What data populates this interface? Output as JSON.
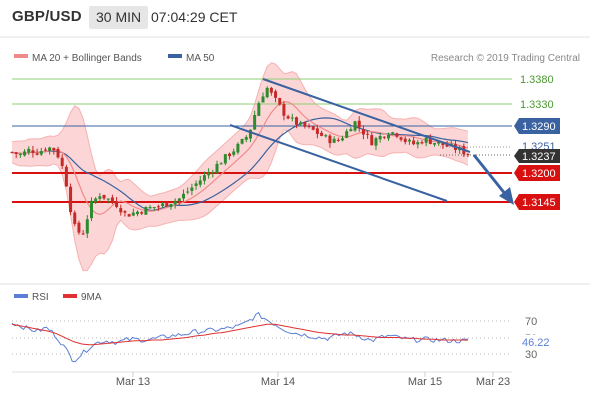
{
  "header": {
    "symbol": "GBP/USD",
    "timeframe": "30 MIN",
    "time": "07:04:29 CET"
  },
  "legend_main": [
    {
      "name": "MA 20 + Bollinger Bands",
      "color": "#f08a8a"
    },
    {
      "name": "MA 50",
      "color": "#3a62a0"
    }
  ],
  "attribution": "Research © 2019 Trading Central",
  "price_tags": {
    "r2": "1.3380",
    "r1": "1.3330",
    "pivot": "1.3290",
    "upper": "1.3251",
    "last": "1.3237",
    "s1": "1.3200",
    "s2": "1.3145"
  },
  "legend_rsi": [
    {
      "name": "RSI",
      "color": "#5b7fd6"
    },
    {
      "name": "9MA",
      "color": "#e03030"
    }
  ],
  "rsi_axis": {
    "level_high": "70",
    "level_mid": "50",
    "level_low": "30",
    "current": "46.22"
  },
  "x_axis": [
    "Mar 13",
    "Mar 14",
    "Mar 15",
    "Mar 23"
  ],
  "colors": {
    "candle_up": "#2e8b2e",
    "candle_down": "#c62828",
    "resistance": "#8ccf74",
    "pivot": "#3a62a0",
    "support": "#d81010",
    "channel": "#3a62a0",
    "arrow": "#3a62a0",
    "band_fill": "#fcd6d6",
    "last_tag": "#333333"
  },
  "chart_data": {
    "type": "candlestick",
    "symbol": "GBP/USD",
    "interval": "30 MIN",
    "x_ticks": [
      "Mar 13",
      "Mar 14",
      "Mar 15",
      "Mar 23"
    ],
    "price_range": [
      1.3045,
      1.3405
    ],
    "key_levels": {
      "resistance_2": 1.338,
      "resistance_1": 1.333,
      "pivot": 1.329,
      "support_1": 1.32,
      "support_2": 1.3145
    },
    "last_price": 1.3237,
    "ma20_close": 1.3245,
    "bollinger_upper": 1.3251,
    "indicators": [
      "MA 20 + Bollinger Bands",
      "MA 50"
    ],
    "outlook": "bearish",
    "price_path": [
      1.324,
      1.3235,
      1.3245,
      1.324,
      1.325,
      1.3245,
      1.32,
      1.31,
      1.308,
      1.314,
      1.316,
      1.315,
      1.314,
      1.312,
      1.3125,
      1.313,
      1.3135,
      1.3138,
      1.3145,
      1.315,
      1.3165,
      1.318,
      1.3195,
      1.321,
      1.3225,
      1.324,
      1.3255,
      1.3275,
      1.333,
      1.3365,
      1.334,
      1.3315,
      1.33,
      1.329,
      1.3285,
      1.3275,
      1.3265,
      1.326,
      1.3275,
      1.33,
      1.328,
      1.326,
      1.327,
      1.328,
      1.3275,
      1.326,
      1.3255,
      1.3265,
      1.326,
      1.3255,
      1.325,
      1.3245,
      1.3237
    ],
    "rsi": {
      "levels": [
        30,
        50,
        70
      ],
      "current": 46.22,
      "rsi_path": [
        68,
        64,
        60,
        58,
        62,
        52,
        38,
        22,
        30,
        40,
        45,
        46,
        44,
        47,
        48,
        47,
        48,
        50,
        52,
        53,
        55,
        57,
        58,
        59,
        60,
        62,
        64,
        70,
        78,
        72,
        66,
        60,
        56,
        54,
        52,
        50,
        49,
        52,
        55,
        54,
        50,
        46,
        50,
        52,
        50,
        48,
        47,
        48,
        47,
        47,
        46,
        46,
        46.22
      ],
      "ma9_path": [
        66,
        64,
        62,
        60,
        58,
        55,
        50,
        45,
        42,
        41,
        42,
        43,
        44,
        45,
        46,
        46,
        47,
        47,
        48,
        49,
        50,
        52,
        53,
        55,
        56,
        58,
        60,
        62,
        64,
        66,
        66,
        64,
        62,
        60,
        58,
        56,
        55,
        54,
        53,
        53,
        52,
        51,
        50,
        50,
        50,
        49,
        49,
        48,
        48,
        47,
        47,
        47,
        46.8
      ]
    }
  }
}
